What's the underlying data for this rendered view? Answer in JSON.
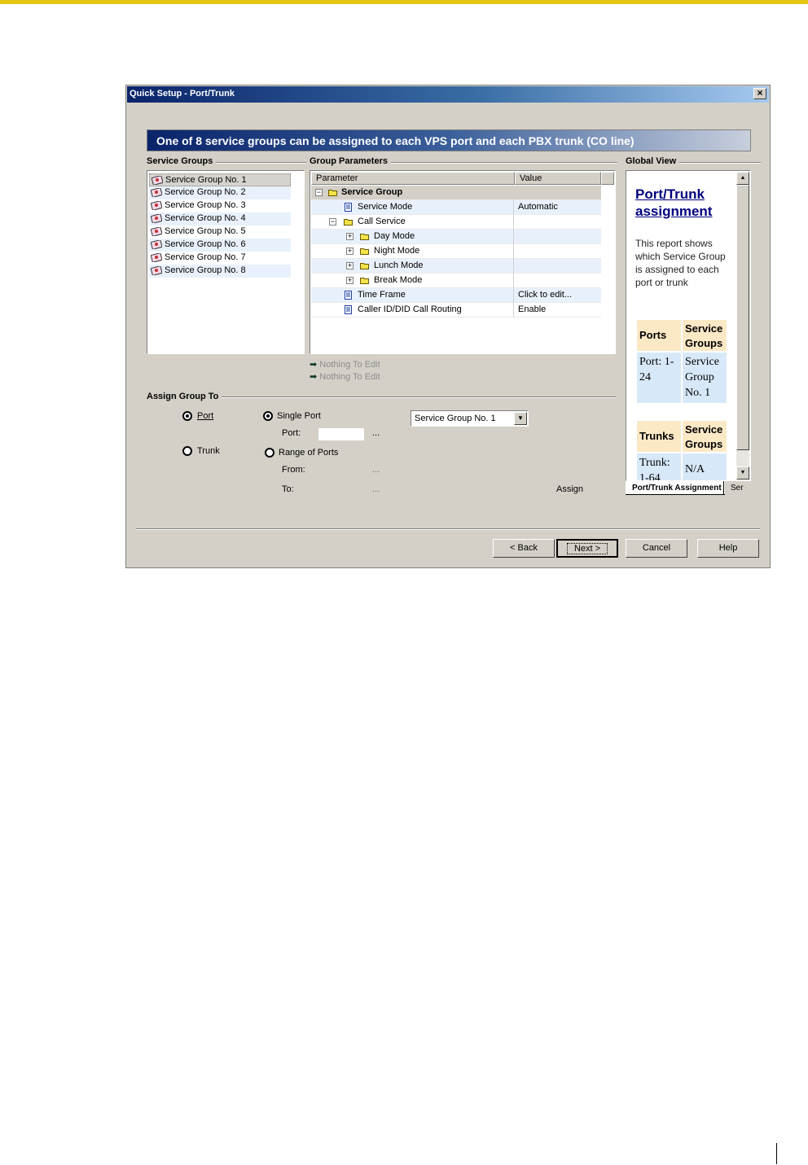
{
  "window": {
    "title": "Quick Setup - Port/Trunk",
    "close_glyph": "×"
  },
  "banner": {
    "text": "One of 8 service groups can be assigned to each VPS port and each PBX trunk (CO line)"
  },
  "service_groups": {
    "label": "Service Groups",
    "items": [
      "Service Group No. 1",
      "Service Group No. 2",
      "Service Group No. 3",
      "Service Group No. 4",
      "Service Group No. 5",
      "Service Group No. 6",
      "Service Group No. 7",
      "Service Group No. 8"
    ],
    "selected_index": 0
  },
  "group_parameters": {
    "label": "Group Parameters",
    "columns": {
      "parameter": "Parameter",
      "value": "Value"
    },
    "rows": [
      {
        "name": "Service Group",
        "value": "",
        "expander": "−",
        "icon": "folder-icon"
      },
      {
        "name": "Service Mode",
        "value": "Automatic",
        "expander": "",
        "icon": "document-icon"
      },
      {
        "name": "Call Service",
        "value": "",
        "expander": "−",
        "icon": "folder-icon"
      },
      {
        "name": "Day Mode",
        "value": "",
        "expander": "+",
        "icon": "folder-icon"
      },
      {
        "name": "Night Mode",
        "value": "",
        "expander": "+",
        "icon": "folder-icon"
      },
      {
        "name": "Lunch Mode",
        "value": "",
        "expander": "+",
        "icon": "folder-icon"
      },
      {
        "name": "Break Mode",
        "value": "",
        "expander": "+",
        "icon": "folder-icon"
      },
      {
        "name": "Time Frame",
        "value": "Click to edit...",
        "expander": "",
        "icon": "document-icon"
      },
      {
        "name": "Caller ID/DID Call Routing",
        "value": "Enable",
        "expander": "",
        "icon": "document-icon"
      }
    ],
    "nothing_to_edit": [
      "Nothing To Edit",
      "Nothing To Edit"
    ],
    "arrow_glyph": "➡"
  },
  "assign": {
    "label": "Assign Group To",
    "port_label": "Port",
    "trunk_label": "Trunk",
    "single_port_label": "Single Port",
    "port_field_label": "Port:",
    "port_value": "",
    "ellipsis": "...",
    "range_label": "Range of Ports",
    "from_label": "From:",
    "to_label": "To:",
    "assign_button": "Assign",
    "group_select_value": "Service Group No. 1"
  },
  "global_view": {
    "label": "Global View",
    "title": "Port/Trunk assignment",
    "description": "This report shows which Service Group is assigned to each port or trunk",
    "port_table": {
      "headers": [
        "Ports",
        "Service Groups"
      ],
      "row": [
        "Port: 1-24",
        "Service Group No. 1"
      ]
    },
    "trunk_table": {
      "headers": [
        "Trunks",
        "Service Groups"
      ],
      "row": [
        "Trunk: 1-64",
        "N/A"
      ]
    },
    "tabs": [
      "Port/Trunk Assignment",
      "Ser"
    ]
  },
  "buttons": {
    "back": "< Back",
    "next": "Next >",
    "cancel": "Cancel",
    "help": "Help"
  },
  "colors": {
    "titlebar": "#0a246a",
    "dialog": "#d4d0c8",
    "link": "#00007f",
    "accent_bar": "#e6c414"
  }
}
